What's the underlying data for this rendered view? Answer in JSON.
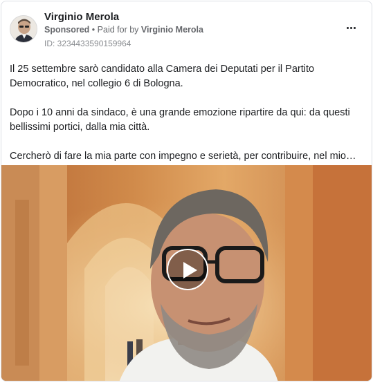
{
  "post": {
    "page_name": "Virginio Merola",
    "sponsored_label": "Sponsored",
    "separator": "•",
    "paid_for_text": "Paid for by",
    "payer_name": "Virginio Merola",
    "ad_id": "ID: 3234433590159964",
    "paragraphs": [
      "Il 25 settembre sarò candidato alla Camera dei Deputati per il Partito Democratico, nel collegio 6 di Bologna.",
      "Dopo i 10 anni da sindaco, è una grande emozione ripartire da qui: da questi bellissimi portici, dalla mia città.",
      "Cercherò di fare la mia parte con impegno e serietà, per contribuire, nel mio…"
    ]
  },
  "icons": {
    "more": "more-options-icon",
    "play": "play-icon"
  },
  "colors": {
    "text_primary": "#1c1e21",
    "text_secondary": "#65676b",
    "border": "#dcdfe4"
  }
}
